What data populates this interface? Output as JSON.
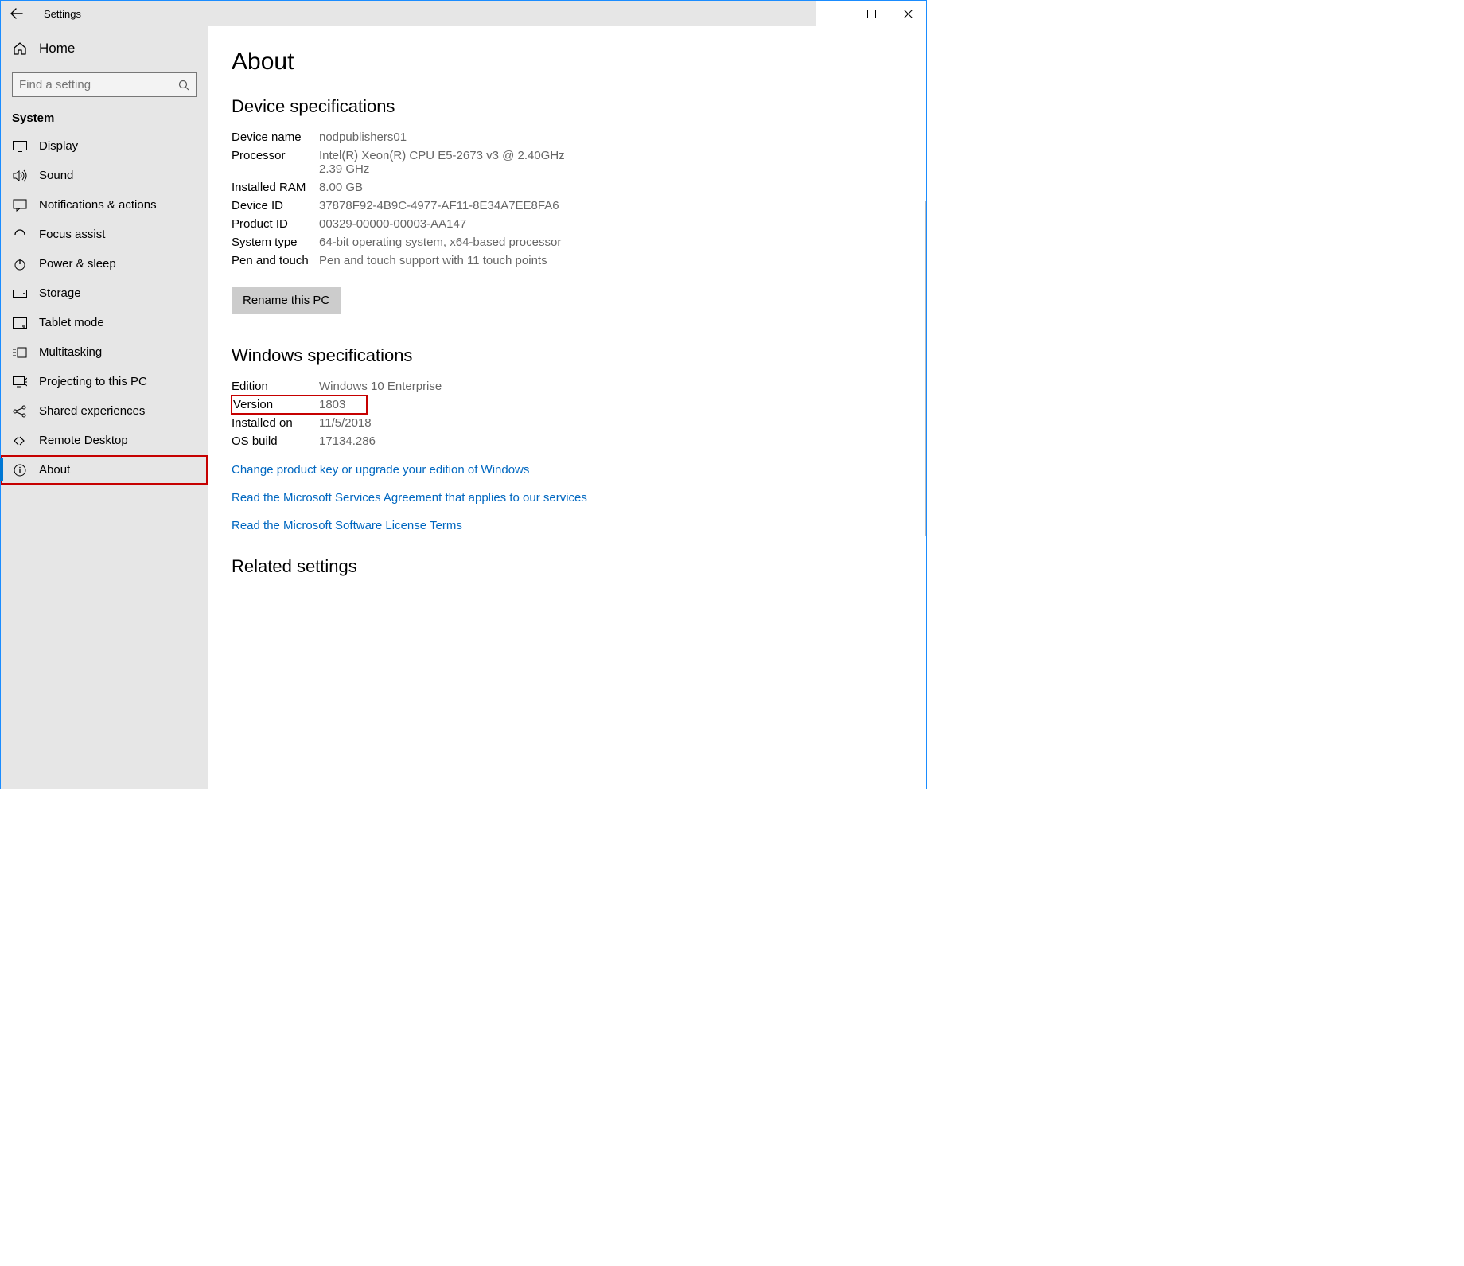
{
  "titlebar": {
    "title": "Settings"
  },
  "sidebar": {
    "home": "Home",
    "search_placeholder": "Find a setting",
    "category": "System",
    "items": [
      {
        "label": "Display"
      },
      {
        "label": "Sound"
      },
      {
        "label": "Notifications & actions"
      },
      {
        "label": "Focus assist"
      },
      {
        "label": "Power & sleep"
      },
      {
        "label": "Storage"
      },
      {
        "label": "Tablet mode"
      },
      {
        "label": "Multitasking"
      },
      {
        "label": "Projecting to this PC"
      },
      {
        "label": "Shared experiences"
      },
      {
        "label": "Remote Desktop"
      },
      {
        "label": "About"
      }
    ]
  },
  "page": {
    "title": "About",
    "device_section": "Device specifications",
    "device": {
      "name_k": "Device name",
      "name_v": "nodpublishers01",
      "proc_k": "Processor",
      "proc_v": "Intel(R) Xeon(R) CPU E5-2673 v3 @ 2.40GHz 2.39 GHz",
      "ram_k": "Installed RAM",
      "ram_v": "8.00 GB",
      "did_k": "Device ID",
      "did_v": "37878F92-4B9C-4977-AF11-8E34A7EE8FA6",
      "pid_k": "Product ID",
      "pid_v": "00329-00000-00003-AA147",
      "type_k": "System type",
      "type_v": "64-bit operating system, x64-based processor",
      "pen_k": "Pen and touch",
      "pen_v": "Pen and touch support with 11 touch points"
    },
    "rename_btn": "Rename this PC",
    "win_section": "Windows specifications",
    "win": {
      "ed_k": "Edition",
      "ed_v": "Windows 10 Enterprise",
      "ver_k": "Version",
      "ver_v": "1803",
      "inst_k": "Installed on",
      "inst_v": "11/5/2018",
      "build_k": "OS build",
      "build_v": "17134.286"
    },
    "links": {
      "change_key": "Change product key or upgrade your edition of Windows",
      "services_agreement": "Read the Microsoft Services Agreement that applies to our services",
      "license_terms": "Read the Microsoft Software License Terms"
    },
    "related_section": "Related settings"
  }
}
